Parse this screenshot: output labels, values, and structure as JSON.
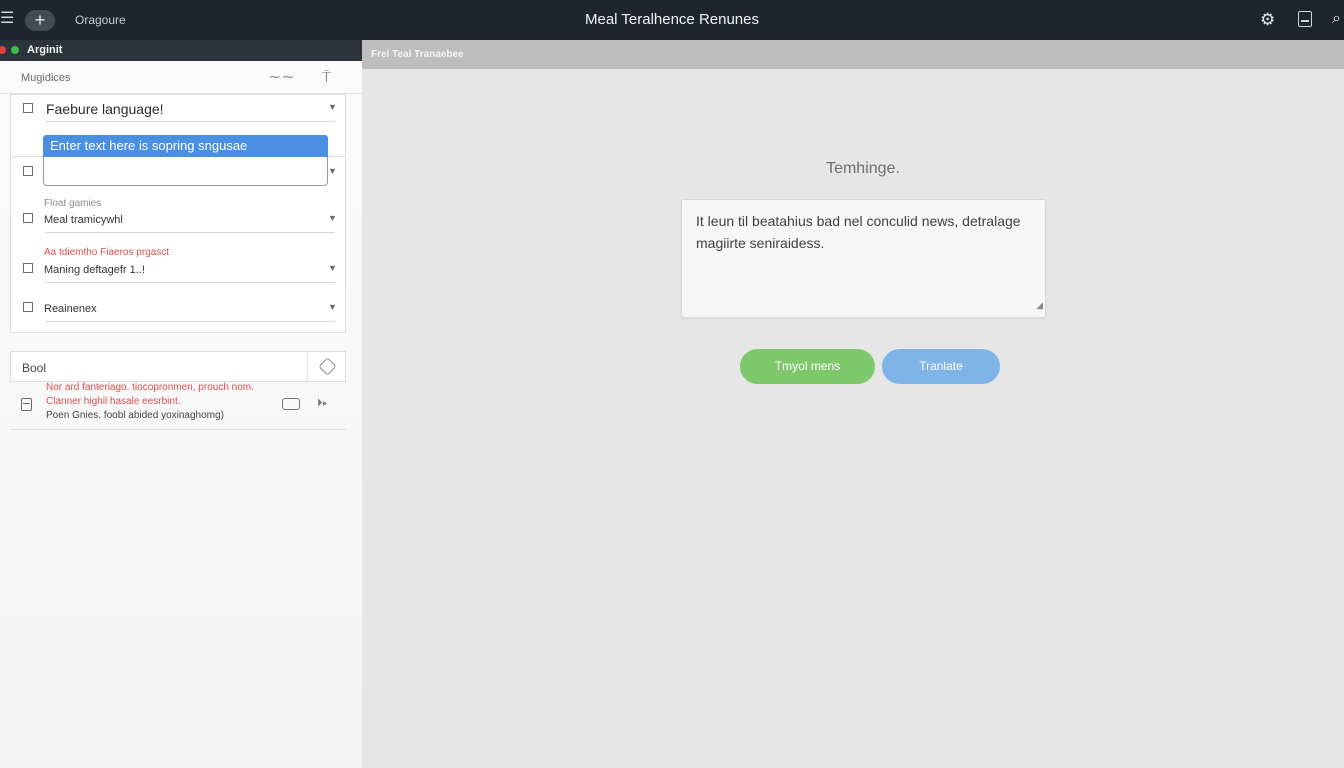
{
  "topbar": {
    "menu_icon": "hamburger-icon",
    "add_icon": "plus-icon",
    "app_label": "Oragoure",
    "title": "Meal Teralhence Renunes",
    "icons": [
      "gear-icon",
      "document-icon",
      "search-icon"
    ]
  },
  "sidebar": {
    "header_label": "Arginit",
    "subhead_label": "Mugidices",
    "card1": {
      "language_label": "Faebure language!"
    },
    "tooltip_text": "Enter text here is sopring sngusae",
    "group_label": "Float gamies",
    "rows": [
      {
        "label": "Meal tramicywhl"
      },
      {
        "red_caption": "Aa tdiemtho Fiaeros prgasct",
        "label": "Maning deftagefr 1..!"
      },
      {
        "label": "Reainenex"
      }
    ],
    "bool_label": "Bool",
    "log": {
      "line1": "Nor ard fanteriago. tiocopronmen, prouch nom.",
      "line2": "Clanner highil hasale eesrbint.",
      "line3": "Poen Gnies. foobl abided yoxinaghomg)"
    }
  },
  "main": {
    "strip_label": "Frel Teal Tranaebee",
    "heading": "Temhinge.",
    "text_value": "It leun til beatahius bad nel conculid news, detralage magiirte seniraidess.",
    "primary_button": "Tmyol mens",
    "translate_button": "Tranlate"
  },
  "colors": {
    "topbar_bg": "#1f252d",
    "green_button": "#7cc86a",
    "blue_button": "#7fb5e6",
    "tooltip_blue": "#4a90e2",
    "error_red": "#d9534f"
  }
}
